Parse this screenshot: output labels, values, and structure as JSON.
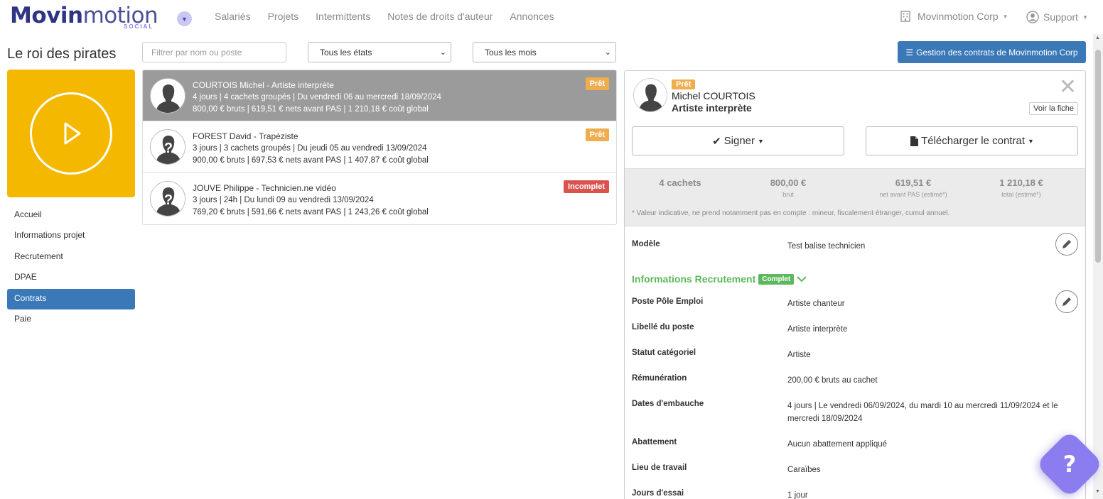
{
  "brand": {
    "name_part1": "Movin",
    "name_part2": "motion",
    "tagline": "SOCIAL"
  },
  "nav": {
    "links": [
      "Salariés",
      "Projets",
      "Intermittents",
      "Notes de droits d'auteur",
      "Annonces"
    ],
    "company": "Movinmotion Corp",
    "support": "Support"
  },
  "project": {
    "title": "Le roi des pirates"
  },
  "sidebar": {
    "items": [
      {
        "label": "Accueil",
        "active": false
      },
      {
        "label": "Informations projet",
        "active": false
      },
      {
        "label": "Recrutement",
        "active": false
      },
      {
        "label": "DPAE",
        "active": false
      },
      {
        "label": "Contrats",
        "active": true
      },
      {
        "label": "Paie",
        "active": false
      }
    ]
  },
  "filters": {
    "search_placeholder": "Filtrer par nom ou poste",
    "state_selected": "Tous les états",
    "month_selected": "Tous les mois",
    "manage_button": "Gestion des contrats de Movinmotion Corp"
  },
  "contracts": [
    {
      "name": "COURTOIS Michel - Artiste interprète",
      "line2": "4 jours | 4 cachets groupés | Du vendredi 06 au mercredi 18/09/2024",
      "line3": "800,00 € bruts | 619,51 € nets avant PAS | 1 210,18 € coût global",
      "status": "Prêt"
    },
    {
      "name": "FOREST David - Trapéziste",
      "line2": "3 jours | 3 cachets groupés | Du jeudi 05 au vendredi 13/09/2024",
      "line3": "900,00 € bruts | 697,53 € nets avant PAS | 1 407,87 € coût global",
      "status": "Prêt"
    },
    {
      "name": "JOUVE Philippe - Technicien.ne vidéo",
      "line2": "3 jours | 24h | Du lundi 09 au vendredi 13/09/2024",
      "line3": "769,20 € bruts | 591,66 € nets avant PAS | 1 243,26 € coût global",
      "status": "Incomplet"
    }
  ],
  "detail": {
    "status": "Prêt",
    "name": "Michel COURTOIS",
    "role": "Artiste interprète",
    "see_card": "Voir la fiche",
    "sign_button": "Signer",
    "download_button": "Télécharger le contrat",
    "stats": [
      {
        "value": "4 cachets",
        "label": ""
      },
      {
        "value": "800,00 €",
        "label": "brut"
      },
      {
        "value": "619,51 €",
        "label": "net avant PAS (estimé*)"
      },
      {
        "value": "1 210,18 €",
        "label": "total (estimé*)"
      }
    ],
    "stats_note": "* Valeur indicative, ne prend notamment pas en compte : mineur, fiscalement étranger, cumul annuel.",
    "model_label": "Modèle",
    "model_value": "Test balise technicien",
    "section_title": "Informations Recrutement",
    "section_badge": "Complet",
    "fields": [
      {
        "label": "Poste Pôle Emploi",
        "value": "Artiste chanteur"
      },
      {
        "label": "Libellé du poste",
        "value": "Artiste interprète"
      },
      {
        "label": "Statut catégoriel",
        "value": "Artiste"
      },
      {
        "label": "Rémunération",
        "value": "200,00 € bruts au cachet"
      },
      {
        "label": "Dates d'embauche",
        "value": "4 jours | Le vendredi 06/09/2024, du mardi 10 au mercredi 11/09/2024 et le mercredi 18/09/2024"
      },
      {
        "label": "Abattement",
        "value": "Aucun abattement appliqué"
      },
      {
        "label": "Lieu de travail",
        "value": "Caraïbes"
      },
      {
        "label": "Jours d'essai",
        "value": "1 jour"
      }
    ]
  },
  "help": {
    "label": "?"
  },
  "colors": {
    "primary": "#3a78b7",
    "tile": "#f5b800",
    "ready": "#f0ad4e",
    "incomplete": "#d9534f",
    "complete": "#5cb85c",
    "help": "#8b7cf0"
  }
}
